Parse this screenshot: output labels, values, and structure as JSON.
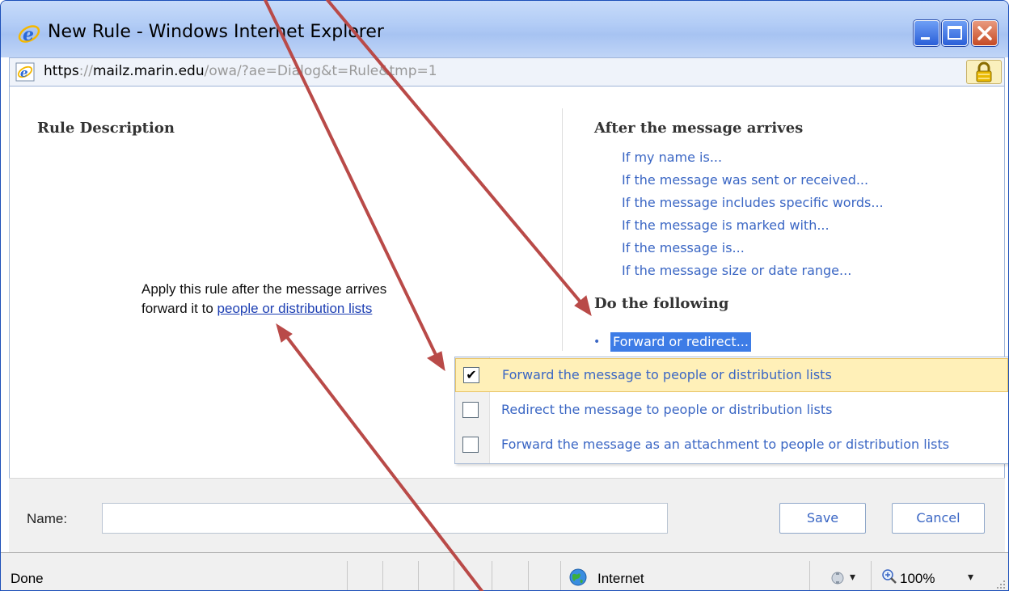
{
  "window": {
    "title": "New Rule - Windows Internet Explorer",
    "controls": {
      "minimize": "minimize-icon",
      "maximize": "maximize-icon",
      "close": "close-icon"
    }
  },
  "address": {
    "scheme": "https",
    "sep": "://",
    "domain": "mailz.marin.edu",
    "path": "/owa/?ae=Dialog&t=Rule&tmp=1",
    "secure_icon": "lock-icon"
  },
  "rule_description": {
    "heading": "Rule Description",
    "line1": "Apply this rule after the message arrives",
    "line2_prefix": "forward it to ",
    "line2_link": "people or distribution lists"
  },
  "conditions": {
    "heading": "After the message arrives",
    "items": [
      "If my name is...",
      "If the message was sent or received...",
      "If the message includes specific words...",
      "If the message is marked with...",
      "If the message is...",
      "If the message size or date range..."
    ]
  },
  "actions": {
    "heading": "Do the following",
    "selected": "Forward or redirect..."
  },
  "dropdown": {
    "items": [
      {
        "label": "Forward the message to people or distribution lists",
        "checked": true
      },
      {
        "label": "Redirect the message to people or distribution lists",
        "checked": false
      },
      {
        "label": "Forward the message as an attachment to people or distribution lists",
        "checked": false
      }
    ]
  },
  "form": {
    "name_label": "Name:",
    "name_value": "",
    "save_label": "Save",
    "cancel_label": "Cancel"
  },
  "status": {
    "text": "Done",
    "zone": "Internet",
    "zoom": "100%",
    "caret": "▾"
  },
  "colors": {
    "link": "#3a66c4",
    "highlight": "#3d7ce6",
    "selected_row": "#fff0b8",
    "annotation_arrow": "#b94a48"
  }
}
